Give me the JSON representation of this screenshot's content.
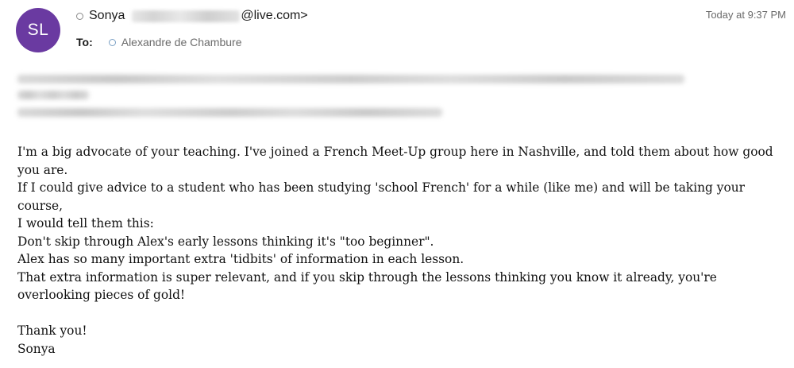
{
  "header": {
    "avatar_initials": "SL",
    "avatar_color": "#6a3aa1",
    "from_name": "Sonya",
    "from_email_domain": "@live.com>",
    "to_label": "To:",
    "to_name": "Alexandre de Chambure",
    "timestamp": "Today at 9:37 PM"
  },
  "body": {
    "paragraphs": [
      "I'm a big advocate of your teaching. I've joined a French Meet-Up group here in Nashville, and told them about how good you are.",
      "If I could give advice to a student who has been studying 'school French' for a while (like me) and will be taking your course,",
      "I would tell them this:",
      "Don't skip through Alex's early lessons thinking it's \"too beginner\".",
      "Alex has so many important extra 'tidbits' of information in each lesson.",
      "That extra information is super relevant, and if you skip through the lessons thinking you know it already, you're overlooking pieces of gold!"
    ],
    "closing": "Thank you!",
    "signature": "Sonya"
  }
}
